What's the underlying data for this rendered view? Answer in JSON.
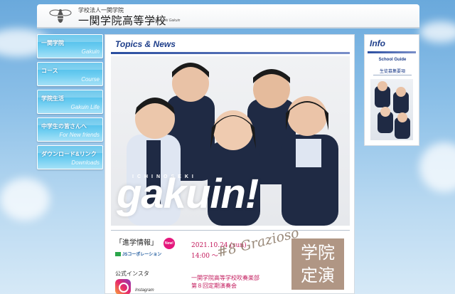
{
  "header": {
    "subtitle": "学校法人一関学院",
    "school_name": "一関学院高等学校",
    "school_name_en": "Ichinoseki Gakuin",
    "logo_icon": "bee-icon"
  },
  "nav": {
    "items": [
      {
        "jp": "一関学院",
        "en": "Gakuin"
      },
      {
        "jp": "コース",
        "en": "Course"
      },
      {
        "jp": "学院生活",
        "en": "Gakuin Life"
      },
      {
        "jp": "中学生の皆さんへ",
        "en": "For New friends"
      },
      {
        "jp": "ダウンロード&リンク",
        "en": "Downloads"
      }
    ]
  },
  "main": {
    "title": "Topics & News",
    "photo": {
      "kicker": "ICHINOSEKI",
      "brand": "gakuin!"
    },
    "news": {
      "shingaku": "「進学情報」",
      "new_badge": "New!",
      "js_logo": "JSコーポレーション",
      "insta_label": "公式インスタ",
      "insta_text": "Instagram"
    },
    "concert": {
      "date": "2021.10.24 (sun)",
      "time": "14:00 〜",
      "script": "#8 Grazioso",
      "org": "一関学院高等学校吹奏楽部",
      "event": "第８回定期演奏会",
      "badge_line1": "学院",
      "badge_line2": "定演"
    }
  },
  "info": {
    "title": "Info",
    "guide_label": "School Guide",
    "guide_sub": "生徒募集要項"
  },
  "colors": {
    "nav_blue": "#3fb6e6",
    "title_navy": "#1e3e8a",
    "concert_pink": "#c2185b",
    "badge_pink": "#e4177c"
  }
}
